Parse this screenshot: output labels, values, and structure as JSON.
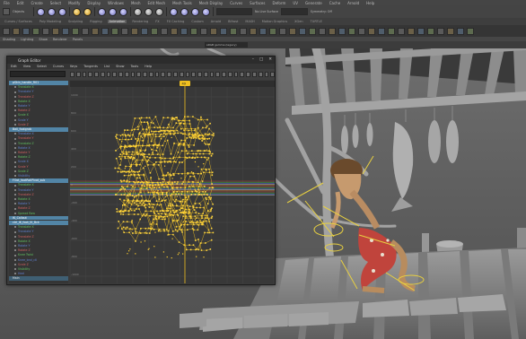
{
  "app": {
    "menubar": [
      "File",
      "Edit",
      "Create",
      "Select",
      "Modify",
      "Display",
      "Windows",
      "Mesh",
      "Edit Mesh",
      "Mesh Tools",
      "Mesh Display",
      "Curves",
      "Surfaces",
      "Deform",
      "UV",
      "Generate",
      "Cache",
      "Arnold",
      "Help"
    ],
    "statusline": {
      "field_label": "Objects",
      "no_live_surface": "No Live Surface",
      "symmetry": "Symmetry: Off"
    },
    "shelf_tabs": [
      "Curves / Surfaces",
      "Poly Modeling",
      "Sculpting",
      "Rigging",
      "Animation",
      "Rendering",
      "FX",
      "FX Caching",
      "Custom",
      "Arnold",
      "Bifrost",
      "MASH",
      "Motion Graphics",
      "XGen",
      "TURTLE"
    ],
    "shelf_active_index": 4,
    "panel_menu": [
      "Shading",
      "Lighting",
      "Show",
      "Renderer",
      "Panels"
    ],
    "panel_camera": "sRGB gamma (legacy)"
  },
  "graph_editor": {
    "title": "Graph Editor",
    "controls": [
      "–",
      "□",
      "✕"
    ],
    "menu": [
      "Edit",
      "View",
      "Select",
      "Curves",
      "Keys",
      "Tangents",
      "List",
      "Show",
      "Tools",
      "Help"
    ],
    "outliner_rows": [
      {
        "label": "pSkin_handle_R01",
        "type": "sel"
      },
      {
        "label": "Translate X",
        "type": "attr"
      },
      {
        "label": "Translate Y",
        "type": "attr"
      },
      {
        "label": "Translate Z",
        "type": "attr"
      },
      {
        "label": "Rotate X",
        "type": "attr"
      },
      {
        "label": "Rotate Y",
        "type": "attr"
      },
      {
        "label": "Rotate Z",
        "type": "attr"
      },
      {
        "label": "Scale X",
        "type": "attr"
      },
      {
        "label": "Scale Y",
        "type": "attr"
      },
      {
        "label": "Scale Z",
        "type": "attr"
      },
      {
        "label": "Ball_footgrab",
        "type": "sel"
      },
      {
        "label": "Translate X",
        "type": "attr"
      },
      {
        "label": "Translate Y",
        "type": "attr"
      },
      {
        "label": "Translate Z",
        "type": "attr"
      },
      {
        "label": "Rotate X",
        "type": "attr"
      },
      {
        "label": "Rotate Y",
        "type": "attr"
      },
      {
        "label": "Rotate Z",
        "type": "attr"
      },
      {
        "label": "Scale X",
        "type": "attr"
      },
      {
        "label": "Scale Y",
        "type": "attr"
      },
      {
        "label": "Scale Z",
        "type": "attr"
      },
      {
        "label": "Visibility",
        "type": "attr"
      },
      {
        "label": "FOot_footRollPivot_sub",
        "type": "sel"
      },
      {
        "label": "Translate X",
        "type": "attr"
      },
      {
        "label": "Translate Y",
        "type": "attr"
      },
      {
        "label": "Translate Z",
        "type": "attr"
      },
      {
        "label": "Rotate X",
        "type": "attr"
      },
      {
        "label": "Rotate Y",
        "type": "attr"
      },
      {
        "label": "Rotate Z",
        "type": "attr"
      },
      {
        "label": "Spread Raw",
        "type": "attr"
      },
      {
        "label": "IK_Callout",
        "type": "sel"
      },
      {
        "label": "ctrl_IK_foot_IK_Bck",
        "type": "sel"
      },
      {
        "label": "Translate X",
        "type": "attr"
      },
      {
        "label": "Translate Y",
        "type": "attr"
      },
      {
        "label": "Translate Z",
        "type": "attr"
      },
      {
        "label": "Rotate X",
        "type": "attr"
      },
      {
        "label": "Rotate Y",
        "type": "attr"
      },
      {
        "label": "Rotate Z",
        "type": "attr"
      },
      {
        "label": "Knee Twist",
        "type": "attr"
      },
      {
        "label": "Knee_bnd_ctl",
        "type": "attr"
      },
      {
        "label": "Scale Z",
        "type": "attr"
      },
      {
        "label": "Visibility",
        "type": "attr"
      },
      {
        "label": "Heel",
        "type": "attr"
      },
      {
        "label": "Main",
        "type": "hdr"
      }
    ],
    "y_ticks": [
      "1000",
      "800",
      "600",
      "400",
      "200",
      "0",
      "-200",
      "-400",
      "-600",
      "-800",
      "-1000"
    ],
    "time_cursor": "49"
  },
  "colors": {
    "accent": "#f0c020",
    "selection": "#5285a6",
    "curve_red": "#d04040",
    "curve_green": "#40c040",
    "curve_blue": "#4060d0"
  }
}
